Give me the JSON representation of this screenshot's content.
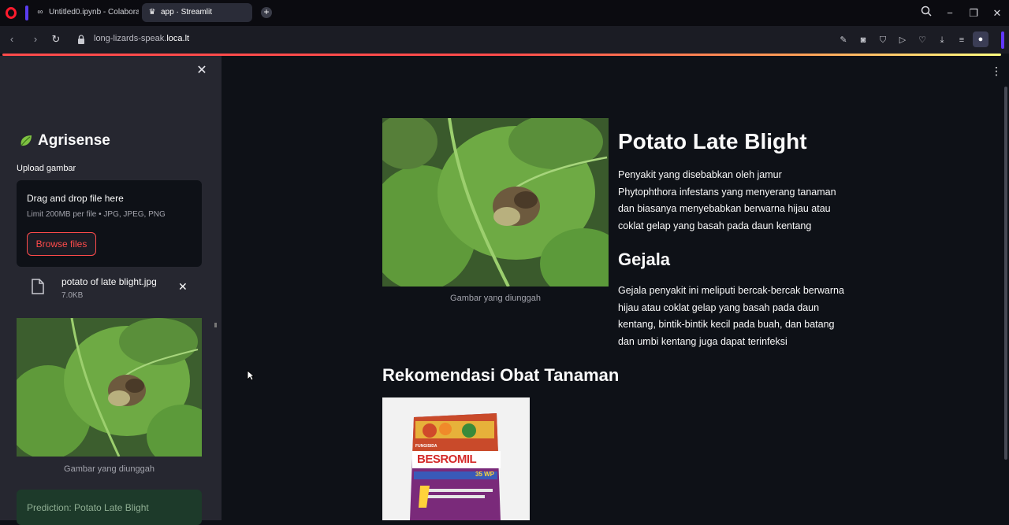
{
  "browser": {
    "tabs": [
      {
        "title": "Untitled0.ipynb - Colabora",
        "icon": "colab-icon"
      },
      {
        "title": "app · Streamlit",
        "icon": "streamlit-icon"
      }
    ],
    "url_host": "long-lizards-speak.",
    "url_domain": "loca.lt",
    "accent_color": "#ff4b4b"
  },
  "sidebar": {
    "brand": "Agrisense",
    "upload_label": "Upload gambar",
    "dropzone": {
      "title": "Drag and drop file here",
      "limit": "Limit 200MB per file • JPG, JPEG, PNG",
      "browse_label": "Browse files"
    },
    "file": {
      "name": "potato of late blight.jpg",
      "size": "7.0KB"
    },
    "image_caption": "Gambar yang diunggah",
    "prediction": "Prediction: Potato Late Blight"
  },
  "main": {
    "image_caption": "Gambar yang diunggah",
    "title": "Potato Late Blight",
    "description": "Penyakit yang disebabkan oleh jamur Phytophthora infestans yang menyerang tanaman dan biasanya menyebabkan berwarna hijau atau coklat gelap yang basah pada daun kentang",
    "symptoms_heading": "Gejala",
    "symptoms": "Gejala penyakit ini meliputi bercak-bercak berwarna hijau atau coklat gelap yang basah pada daun kentang, bintik-bintik kecil pada buah, dan batang dan umbi kentang juga dapat terinfeksi",
    "recommendation_heading": "Rekomendasi Obat Tanaman",
    "product": {
      "label_top": "FUNGISIDA",
      "brand": "BESROMIL",
      "grade": "35 WP"
    }
  }
}
